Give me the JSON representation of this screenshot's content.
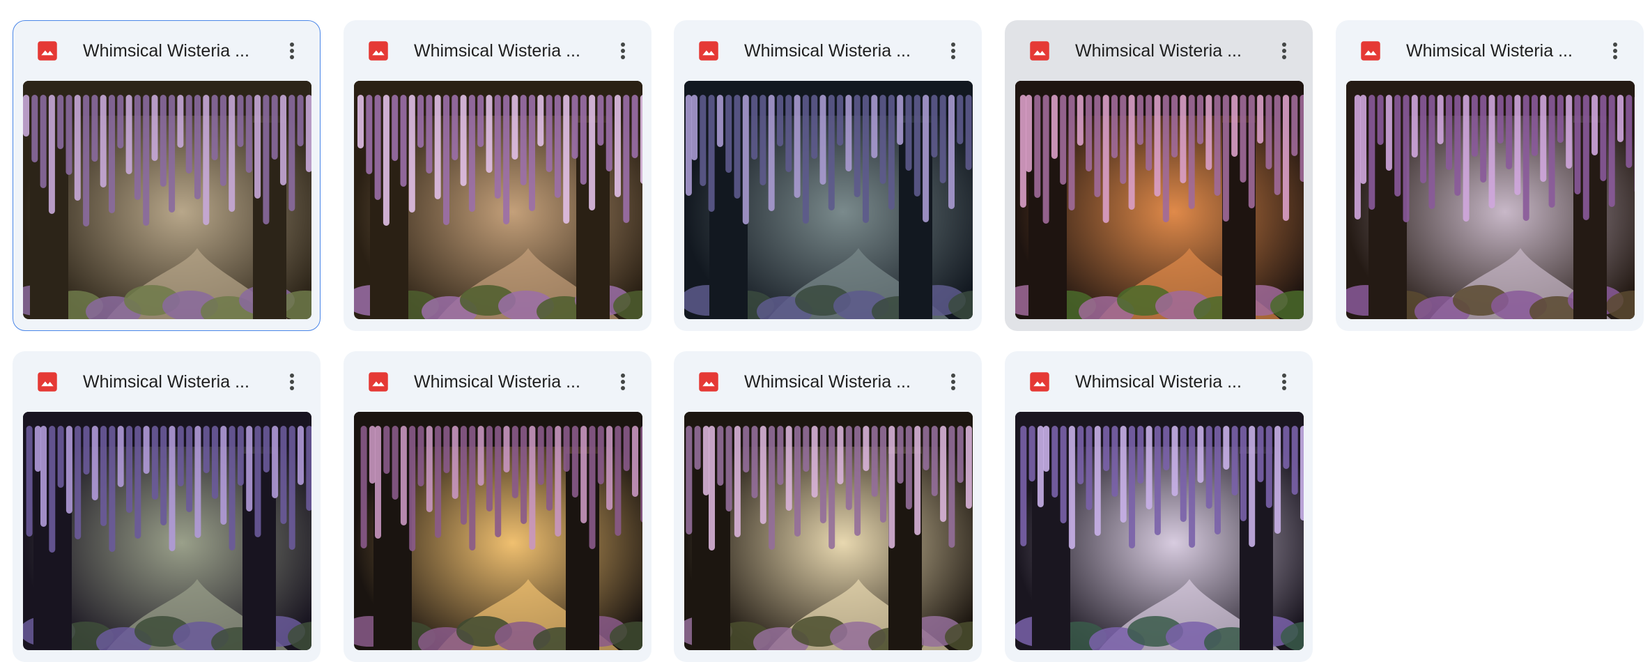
{
  "files": [
    {
      "title": "Whimsical Wisteria ...",
      "state": "selected"
    },
    {
      "title": "Whimsical Wisteria ...",
      "state": ""
    },
    {
      "title": "Whimsical Wisteria ...",
      "state": ""
    },
    {
      "title": "Whimsical Wisteria ...",
      "state": "hovered"
    },
    {
      "title": "Whimsical Wisteria ...",
      "state": ""
    },
    {
      "title": "Whimsical Wisteria ...",
      "state": ""
    },
    {
      "title": "Whimsical Wisteria ...",
      "state": ""
    },
    {
      "title": "Whimsical Wisteria ...",
      "state": ""
    },
    {
      "title": "Whimsical Wisteria ...",
      "state": ""
    }
  ],
  "icons": {
    "file_type": "image-file-icon",
    "more": "more-vert-icon"
  },
  "colors": {
    "card_bg": "#f0f4f9",
    "card_hover_bg": "#e1e3e7",
    "selected_border": "#4a86e8",
    "image_icon_red": "#e53935",
    "title_text": "#1f1f1f"
  }
}
